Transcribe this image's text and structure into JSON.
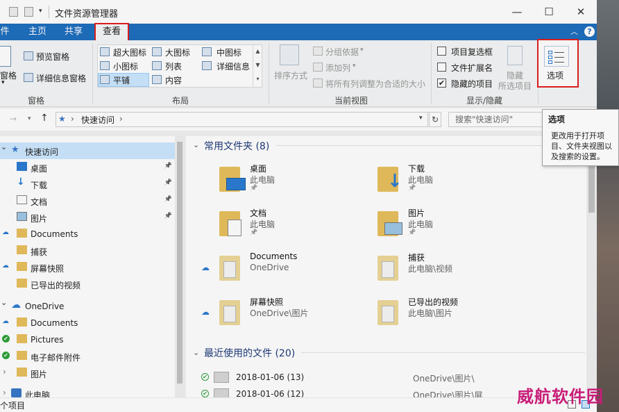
{
  "window": {
    "title": "文件资源管理器"
  },
  "tabs": {
    "file": "件",
    "home": "主页",
    "share": "共享",
    "view": "查看"
  },
  "ribbon": {
    "pane": {
      "preview": "预览窗格",
      "details": "详细信息窗格",
      "nav_left1": "窗格",
      "nav_left2": "▾",
      "group": "窗格"
    },
    "layout": {
      "extra_large": "超大图标",
      "large": "大图标",
      "medium": "中图标",
      "small": "小图标",
      "list": "列表",
      "details": "详细信息",
      "tiles": "平铺",
      "content": "内容",
      "group": "布局"
    },
    "current_view": {
      "sort": "排序方式",
      "group_by": "分组依据",
      "add_column": "添加列",
      "fit_columns": "将所有列调整为合适的大小",
      "group": "当前视图"
    },
    "show_hide": {
      "item_checkboxes": "项目复选框",
      "file_extensions": "文件扩展名",
      "hidden_items": "隐藏的项目",
      "hide_selected_1": "隐藏",
      "hide_selected_2": "所选项目",
      "group": "显示/隐藏",
      "item_checkboxes_checked": false,
      "file_extensions_checked": false,
      "hidden_items_checked": true
    },
    "options": {
      "label": "选项"
    }
  },
  "address": {
    "path": "快速访问",
    "search_placeholder": "搜索\"快速访问\""
  },
  "nav": [
    {
      "label": "快速访问",
      "pin": false,
      "selected": true
    },
    {
      "label": "桌面",
      "pin": true
    },
    {
      "label": "下载",
      "pin": true
    },
    {
      "label": "文档",
      "pin": true
    },
    {
      "label": "图片",
      "pin": true
    },
    {
      "label": "Documents",
      "pin": false
    },
    {
      "label": "捕获",
      "pin": false
    },
    {
      "label": "屏幕快照",
      "pin": false
    },
    {
      "label": "已导出的视频",
      "pin": false
    },
    {
      "label": "OneDrive",
      "pin": false
    },
    {
      "label": "Documents",
      "pin": false
    },
    {
      "label": "Pictures",
      "pin": false
    },
    {
      "label": "电子邮件附件",
      "pin": false
    },
    {
      "label": "图片",
      "pin": false
    },
    {
      "label": "此电脑",
      "pin": false
    }
  ],
  "frequent": {
    "header": "常用文件夹 (8)",
    "folders": [
      {
        "name": "桌面",
        "loc": "此电脑"
      },
      {
        "name": "下载",
        "loc": "此电脑"
      },
      {
        "name": "文档",
        "loc": "此电脑"
      },
      {
        "name": "图片",
        "loc": "此电脑"
      },
      {
        "name": "Documents",
        "loc": "OneDrive"
      },
      {
        "name": "捕获",
        "loc": "此电脑\\视频"
      },
      {
        "name": "屏幕快照",
        "loc": "OneDrive\\图片"
      },
      {
        "name": "已导出的视频",
        "loc": "此电脑\\图片"
      }
    ]
  },
  "recent": {
    "header": "最近使用的文件 (20)",
    "files": [
      {
        "name": "2018-01-06 (13)",
        "loc": "OneDrive\\图片\\"
      },
      {
        "name": "2018-01-06 (12)",
        "loc": "OneDrive\\图片\\屏..."
      }
    ]
  },
  "status": {
    "count": "个项目"
  },
  "tooltip": {
    "title": "选项",
    "body": "更改用于打开项目、文件夹视图以及搜索的设置。"
  },
  "watermark": "威航软件园",
  "colors": {
    "tabbar": "#1f6fbf",
    "selection": "#cce8ff",
    "highlight": "#e02020",
    "folder": "#e9c05d"
  }
}
